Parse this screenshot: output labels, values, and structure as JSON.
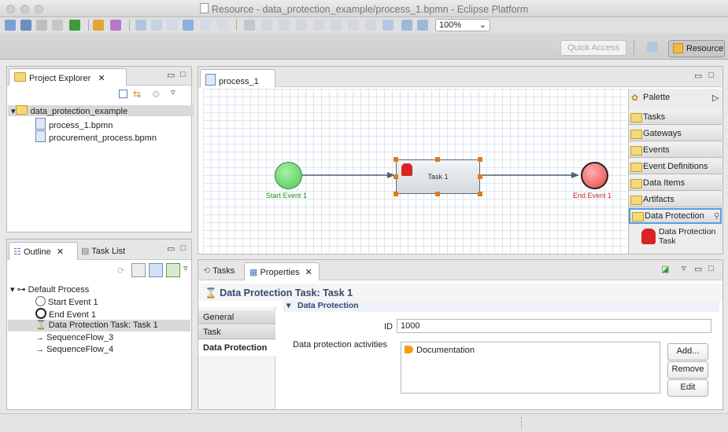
{
  "window": {
    "title": "Resource - data_protection_example/process_1.bpmn - Eclipse Platform"
  },
  "toolbar": {
    "zoom": "100%",
    "quick_access": "Quick Access",
    "perspective": "Resource"
  },
  "project_explorer": {
    "tab": "Project Explorer",
    "items": [
      {
        "label": "data_protection_example"
      },
      {
        "label": "process_1.bpmn"
      },
      {
        "label": "procurement_process.bpmn"
      }
    ]
  },
  "outline": {
    "tab": "Outline",
    "tab2": "Task List",
    "items": [
      {
        "label": "Default Process"
      },
      {
        "label": "Start Event 1"
      },
      {
        "label": "End Event 1"
      },
      {
        "label": "Data Protection Task: Task 1"
      },
      {
        "label": "SequenceFlow_3"
      },
      {
        "label": "SequenceFlow_4"
      }
    ]
  },
  "editor": {
    "tab": "process_1",
    "start_event": "Start Event 1",
    "task": "Task 1",
    "end_event": "End Event 1"
  },
  "palette": {
    "title": "Palette",
    "groups": [
      "Tasks",
      "Gateways",
      "Events",
      "Event Definitions",
      "Data Items",
      "Artifacts",
      "Data Protection"
    ],
    "tool": "Data Protection Task"
  },
  "properties": {
    "tab1": "Tasks",
    "tab2": "Properties",
    "heading": "Data Protection Task: Task 1",
    "side_tabs": [
      "General",
      "Task",
      "Data Protection"
    ],
    "section": "Data Protection",
    "id_label": "ID",
    "id_value": "1000",
    "activities_label": "Data protection activities",
    "activities": [
      "Documentation"
    ],
    "buttons": {
      "add": "Add...",
      "remove": "Remove",
      "edit": "Edit"
    }
  },
  "colors": {
    "start": "#5fd35f",
    "end": "#f05a5a",
    "task": "#e1e6ea",
    "selection": "#e07a1a"
  }
}
